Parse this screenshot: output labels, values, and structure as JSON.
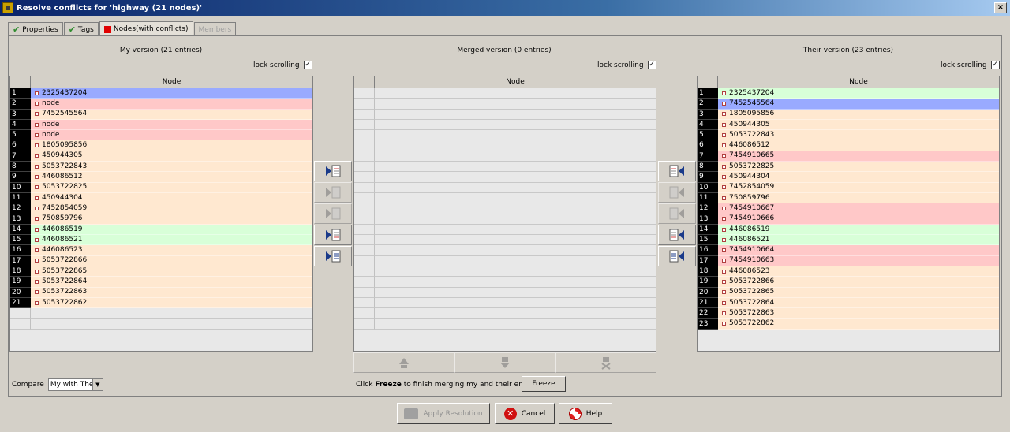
{
  "window": {
    "title": "Resolve conflicts for 'highway (21 nodes)'",
    "close": "×"
  },
  "tabs": [
    {
      "label": "Properties"
    },
    {
      "label": "Tags"
    },
    {
      "label": "Nodes(with conflicts)"
    },
    {
      "label": "Members"
    }
  ],
  "my": {
    "title": "My version (21 entries)",
    "lock_label": "lock scrolling",
    "header": "Node",
    "rows": [
      {
        "n": "1",
        "v": "2325437204",
        "c": "blue"
      },
      {
        "n": "2",
        "v": "node",
        "c": "pink"
      },
      {
        "n": "3",
        "v": "7452545564",
        "c": "peach"
      },
      {
        "n": "4",
        "v": "node",
        "c": "pink"
      },
      {
        "n": "5",
        "v": "node",
        "c": "pink"
      },
      {
        "n": "6",
        "v": "1805095856",
        "c": "peach"
      },
      {
        "n": "7",
        "v": "450944305",
        "c": "peach"
      },
      {
        "n": "8",
        "v": "5053722843",
        "c": "peach"
      },
      {
        "n": "9",
        "v": "446086512",
        "c": "peach"
      },
      {
        "n": "10",
        "v": "5053722825",
        "c": "peach"
      },
      {
        "n": "11",
        "v": "450944304",
        "c": "peach"
      },
      {
        "n": "12",
        "v": "7452854059",
        "c": "peach"
      },
      {
        "n": "13",
        "v": "750859796",
        "c": "peach"
      },
      {
        "n": "14",
        "v": "446086519",
        "c": "green"
      },
      {
        "n": "15",
        "v": "446086521",
        "c": "green"
      },
      {
        "n": "16",
        "v": "446086523",
        "c": "peach"
      },
      {
        "n": "17",
        "v": "5053722866",
        "c": "peach"
      },
      {
        "n": "18",
        "v": "5053722865",
        "c": "peach"
      },
      {
        "n": "19",
        "v": "5053722864",
        "c": "peach"
      },
      {
        "n": "20",
        "v": "5053722863",
        "c": "peach"
      },
      {
        "n": "21",
        "v": "5053722862",
        "c": "peach"
      }
    ]
  },
  "merged": {
    "title": "Merged version (0 entries)",
    "lock_label": "lock scrolling",
    "header": "Node"
  },
  "their": {
    "title": "Their version (23 entries)",
    "lock_label": "lock scrolling",
    "header": "Node",
    "rows": [
      {
        "n": "1",
        "v": "2325437204",
        "c": "green"
      },
      {
        "n": "2",
        "v": "7452545564",
        "c": "blue"
      },
      {
        "n": "3",
        "v": "1805095856",
        "c": "peach"
      },
      {
        "n": "4",
        "v": "450944305",
        "c": "peach"
      },
      {
        "n": "5",
        "v": "5053722843",
        "c": "peach"
      },
      {
        "n": "6",
        "v": "446086512",
        "c": "peach"
      },
      {
        "n": "7",
        "v": "7454910665",
        "c": "pink"
      },
      {
        "n": "8",
        "v": "5053722825",
        "c": "peach"
      },
      {
        "n": "9",
        "v": "450944304",
        "c": "peach"
      },
      {
        "n": "10",
        "v": "7452854059",
        "c": "peach"
      },
      {
        "n": "11",
        "v": "750859796",
        "c": "peach"
      },
      {
        "n": "12",
        "v": "7454910667",
        "c": "pink"
      },
      {
        "n": "13",
        "v": "7454910666",
        "c": "pink"
      },
      {
        "n": "14",
        "v": "446086519",
        "c": "green"
      },
      {
        "n": "15",
        "v": "446086521",
        "c": "green"
      },
      {
        "n": "16",
        "v": "7454910664",
        "c": "pink"
      },
      {
        "n": "17",
        "v": "7454910663",
        "c": "pink"
      },
      {
        "n": "18",
        "v": "446086523",
        "c": "peach"
      },
      {
        "n": "19",
        "v": "5053722866",
        "c": "peach"
      },
      {
        "n": "20",
        "v": "5053722865",
        "c": "peach"
      },
      {
        "n": "21",
        "v": "5053722864",
        "c": "peach"
      },
      {
        "n": "22",
        "v": "5053722863",
        "c": "peach"
      },
      {
        "n": "23",
        "v": "5053722862",
        "c": "peach"
      }
    ]
  },
  "compare": {
    "label": "Compare",
    "value": "My with Their"
  },
  "freeze": {
    "text_before": "Click ",
    "text_bold": "Freeze",
    "text_after": " to finish merging my and their entries.",
    "button": "Freeze"
  },
  "footer": {
    "apply": "Apply Resolution",
    "cancel": "Cancel",
    "help": "Help"
  },
  "colors": {
    "blue": "#99aaff",
    "pink": "#ffc8c8",
    "peach": "#ffe8d0",
    "green": "#d8ffd8"
  }
}
